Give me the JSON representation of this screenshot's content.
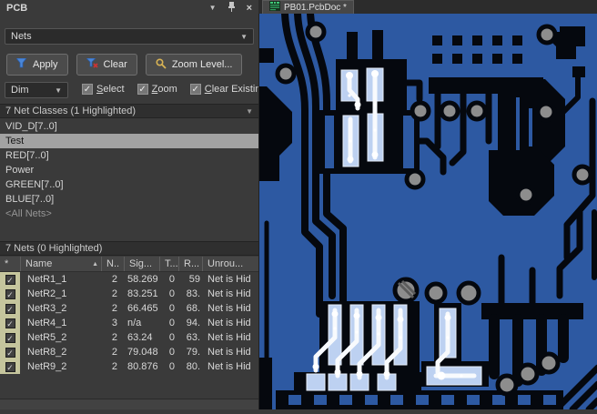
{
  "icons": {
    "dropdown_arrow": "▼",
    "close": "×",
    "check": "✓",
    "sort_asc": "▲"
  },
  "panel": {
    "title": "PCB",
    "mode_dropdown": "Nets",
    "buttons": {
      "apply": "Apply",
      "clear": "Clear",
      "zoom_level": "Zoom Level..."
    },
    "dim_dropdown": "Dim",
    "checkboxes": [
      {
        "key": "S",
        "rest": "elect"
      },
      {
        "key": "Z",
        "rest": "oom"
      },
      {
        "key": "C",
        "rest": "lear Existing"
      }
    ],
    "net_classes": {
      "header": "7 Net Classes (1 Highlighted)",
      "items": [
        {
          "label": "VID_D[7..0]"
        },
        {
          "label": "Test"
        },
        {
          "label": "RED[7..0]"
        },
        {
          "label": "Power"
        },
        {
          "label": "GREEN[7..0]"
        },
        {
          "label": "BLUE[7..0]"
        },
        {
          "label": "<All Nets>"
        }
      ]
    },
    "nets": {
      "header": "7 Nets (0 Highlighted)",
      "columns": {
        "star": "*",
        "name": "Name",
        "n": "N..",
        "sig": "Sig...",
        "t": "T...",
        "r": "R...",
        "unrouted": "Unrou..."
      },
      "rows": [
        {
          "name": "NetR1_1",
          "n": "2",
          "sig": "58.269",
          "t": "0",
          "r": "59",
          "un": "Net is Hid"
        },
        {
          "name": "NetR2_1",
          "n": "2",
          "sig": "83.251",
          "t": "0",
          "r": "83.",
          "un": "Net is Hid"
        },
        {
          "name": "NetR3_2",
          "n": "2",
          "sig": "66.465",
          "t": "0",
          "r": "68.",
          "un": "Net is Hid"
        },
        {
          "name": "NetR4_1",
          "n": "3",
          "sig": "n/a",
          "t": "0",
          "r": "94.",
          "un": "Net is Hid"
        },
        {
          "name": "NetR5_2",
          "n": "2",
          "sig": "63.24",
          "t": "0",
          "r": "63.",
          "un": "Net is Hid"
        },
        {
          "name": "NetR8_2",
          "n": "2",
          "sig": "79.048",
          "t": "0",
          "r": "79.",
          "un": "Net is Hid"
        },
        {
          "name": "NetR9_2",
          "n": "2",
          "sig": "80.876",
          "t": "0",
          "r": "80.",
          "un": "Net is Hid"
        }
      ]
    }
  },
  "editor": {
    "tab": "PB01.PcbDoc *",
    "colors": {
      "copper": "#2d59a2",
      "clearance": "#05080e",
      "via": "#8d8d8d",
      "highlight_fill": "#bdd1f1",
      "highlight_trace": "#f8fafd"
    }
  }
}
